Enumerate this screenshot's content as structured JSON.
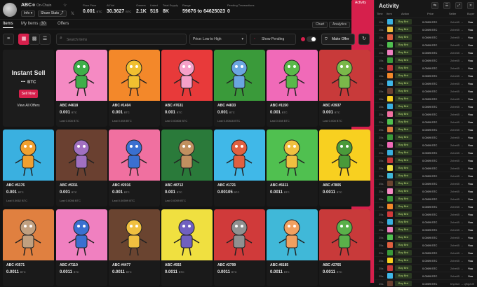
{
  "header": {
    "name": "ABC",
    "status": "On-Chain",
    "info_label": "Info",
    "share_label": "Share Stats",
    "stats": [
      {
        "label": "Floor Price",
        "value": "0.001",
        "unit": "BTC"
      },
      {
        "label": "All Vol",
        "value": "30.3627",
        "unit": "BTC"
      },
      {
        "label": "Owners",
        "value": "2.1K"
      },
      {
        "label": "Listed",
        "value": "516"
      },
      {
        "label": "Total Supply",
        "value": "8K"
      },
      {
        "label": "Range",
        "value": "59676 to 64625023"
      },
      {
        "label": "Pending Transactions",
        "value": "0"
      }
    ]
  },
  "tabs": {
    "items": "Items",
    "my_items": "My Items",
    "my_items_count": "30",
    "offers": "Offers"
  },
  "view_tabs": [
    "Chart",
    "Analytics",
    "Activity"
  ],
  "toolbar": {
    "search_placeholder": "Search items",
    "sort": "Price: Low to High",
    "pending": "Show Pending",
    "make_offer": "Make Offer"
  },
  "sell": {
    "title": "Instant Sell",
    "price": "--",
    "unit": "BTC",
    "button": "Sell Now",
    "view_all": "View All Offers"
  },
  "cards": [
    {
      "name": "ABC #4618",
      "price": "0.001",
      "unit": "BTC",
      "last": "Last 0.008 BTC",
      "bg": "#f58ac3",
      "fg": "#3fae4a"
    },
    {
      "name": "ABC #1404",
      "price": "0.001",
      "unit": "BTC",
      "last": "Last 0.008 BTC",
      "bg": "#f3882a",
      "fg": "#f0c030"
    },
    {
      "name": "ABC #7631",
      "price": "0.001",
      "unit": "BTC",
      "last": "Last 0.00808 BTC",
      "bg": "#e83a3a",
      "fg": "#f5a0c8"
    },
    {
      "name": "ABC #4833",
      "price": "0.001",
      "unit": "BTC",
      "last": "Last 0.00816 BTC",
      "bg": "#3a9a3a",
      "fg": "#6aa6e0"
    },
    {
      "name": "ABC #1150",
      "price": "0.001",
      "unit": "BTC",
      "last": "Last 0.008 BTC",
      "bg": "#f06ab8",
      "fg": "#5ab84a"
    },
    {
      "name": "ABC #3937",
      "price": "0.001",
      "unit": "BTC",
      "last": "Last 0.008 BTC",
      "bg": "#c83a3a",
      "fg": "#7ab84a"
    },
    {
      "name": "ABC #5176",
      "price": "0.001",
      "unit": "BTC",
      "last": "Last 0.0062 BTC",
      "bg": "#3ab0e0",
      "fg": "#f0a030"
    },
    {
      "name": "ABC #9311",
      "price": "0.001",
      "unit": "BTC",
      "last": "Last 0.0056 BTC",
      "bg": "#6a4030",
      "fg": "#a070c0"
    },
    {
      "name": "ABC #2016",
      "price": "0.001",
      "unit": "BTC",
      "last": "Last 0.00599 BTC",
      "bg": "#f070a0",
      "fg": "#3a70d0"
    },
    {
      "name": "ABC #8712",
      "price": "0.001",
      "unit": "BTC",
      "last": "Last 0.0059 BTC",
      "bg": "#2a7a3a",
      "fg": "#c09060"
    },
    {
      "name": "ABC #1721",
      "price": "0.00105",
      "unit": "BTC",
      "last": "",
      "bg": "#40b8e8",
      "fg": "#e06040"
    },
    {
      "name": "ABC #5611",
      "price": "0.0011",
      "unit": "BTC",
      "last": "",
      "bg": "#50c050",
      "fg": "#f0c040"
    },
    {
      "name": "ABC #7805",
      "price": "0.0011",
      "unit": "BTC",
      "last": "",
      "bg": "#f8d020",
      "fg": "#4a9a3a"
    },
    {
      "name": "ABC #3571",
      "price": "0.0011",
      "unit": "BTC",
      "last": "",
      "bg": "#e08040",
      "fg": "#c0a080"
    },
    {
      "name": "ABC #7110",
      "price": "0.0011",
      "unit": "BTC",
      "last": "",
      "bg": "#f080c0",
      "fg": "#3a70d0"
    },
    {
      "name": "ABC #4477",
      "price": "0.0011",
      "unit": "BTC",
      "last": "",
      "bg": "#6a4430",
      "fg": "#f0c040"
    },
    {
      "name": "ABC #592",
      "price": "0.0011",
      "unit": "BTC",
      "last": "",
      "bg": "#f0e040",
      "fg": "#7060c0"
    },
    {
      "name": "ABC #2799",
      "price": "0.0011",
      "unit": "BTC",
      "last": "",
      "bg": "#d03a3a",
      "fg": "#909090"
    },
    {
      "name": "ABC #8185",
      "price": "0.0011",
      "unit": "BTC",
      "last": "",
      "bg": "#40b8d8",
      "fg": "#f0a060"
    },
    {
      "name": "ABC #2765",
      "price": "0.0011",
      "unit": "BTC",
      "last": "",
      "bg": "#c83a3a",
      "fg": "#5ab04a"
    }
  ],
  "activity": {
    "title": "Activity",
    "columns": [
      "Time",
      "Item",
      "Action",
      "Price",
      "Seller",
      "Buyer"
    ],
    "rows": [
      {
        "t": "15s",
        "a": "Buy Brd",
        "p": "0.0009 BTC",
        "s": "2zhe65 →",
        "b": "You",
        "c": "#3ab0e0"
      },
      {
        "t": "15s",
        "a": "Buy Brd",
        "p": "0.0009 BTC",
        "s": "2zhe65 →",
        "b": "You",
        "c": "#f0c040"
      },
      {
        "t": "15s",
        "a": "Buy Brd",
        "p": "0.0009 BTC",
        "s": "2zhe65 →",
        "b": "You",
        "c": "#e06040"
      },
      {
        "t": "15s",
        "a": "Buy Brd",
        "p": "0.0009 BTC",
        "s": "2zhe65 →",
        "b": "You",
        "c": "#50c050"
      },
      {
        "t": "15s",
        "a": "Buy Brd",
        "p": "0.0009 BTC",
        "s": "2zhe65 →",
        "b": "You",
        "c": "#f080c0"
      },
      {
        "t": "15s",
        "a": "Buy Brd",
        "p": "0.0009 BTC",
        "s": "2zhe65 →",
        "b": "You",
        "c": "#3a9a3a"
      },
      {
        "t": "15s",
        "a": "Buy Brd",
        "p": "0.0009 BTC",
        "s": "2zhe65 →",
        "b": "You",
        "c": "#c83a3a"
      },
      {
        "t": "15s",
        "a": "Buy Brd",
        "p": "0.0009 BTC",
        "s": "2zhe65 →",
        "b": "You",
        "c": "#f3882a"
      },
      {
        "t": "15s",
        "a": "Buy Brd",
        "p": "0.0009 BTC",
        "s": "2zhe65 →",
        "b": "You",
        "c": "#40b8e8"
      },
      {
        "t": "15s",
        "a": "Buy Brd",
        "p": "0.0009 BTC",
        "s": "2zhe65 →",
        "b": "You",
        "c": "#6a4030"
      },
      {
        "t": "15s",
        "a": "Buy Brd",
        "p": "0.0009 BTC",
        "s": "2zhe65 →",
        "b": "You",
        "c": "#f8d020"
      },
      {
        "t": "15s",
        "a": "Buy Brd",
        "p": "0.0009 BTC",
        "s": "2zhe65 →",
        "b": "You",
        "c": "#3ab0e0"
      },
      {
        "t": "25s",
        "a": "Buy Brd",
        "p": "0.0009 BTC",
        "s": "2zhe65 →",
        "b": "You",
        "c": "#f070a0"
      },
      {
        "t": "25s",
        "a": "Buy Brd",
        "p": "0.0009 BTC",
        "s": "2zhe65 →",
        "b": "You",
        "c": "#50c050"
      },
      {
        "t": "25s",
        "a": "Buy Brd",
        "p": "0.0009 BTC",
        "s": "2zhe65 →",
        "b": "You",
        "c": "#e08040"
      },
      {
        "t": "25s",
        "a": "Buy Brd",
        "p": "0.0009 BTC",
        "s": "2zhe65 →",
        "b": "You",
        "c": "#3a9a3a"
      },
      {
        "t": "25s",
        "a": "Buy Brd",
        "p": "0.0009 BTC",
        "s": "2zhe65 →",
        "b": "You",
        "c": "#f06ab8"
      },
      {
        "t": "25s",
        "a": "Buy Brd",
        "p": "0.0009 BTC",
        "s": "2zhe65 →",
        "b": "You",
        "c": "#3ab0e0"
      },
      {
        "t": "25s",
        "a": "Buy Brd",
        "p": "0.0009 BTC",
        "s": "2zhe65 →",
        "b": "You",
        "c": "#c83a3a"
      },
      {
        "t": "25s",
        "a": "Buy Brd",
        "p": "0.0009 BTC",
        "s": "2zhe65 →",
        "b": "You",
        "c": "#f0e040"
      },
      {
        "t": "25s",
        "a": "Buy Brd",
        "p": "0.0009 BTC",
        "s": "2zhe65 →",
        "b": "You",
        "c": "#40b8d8"
      },
      {
        "t": "25s",
        "a": "Buy Brd",
        "p": "0.0009 BTC",
        "s": "2zhe65 →",
        "b": "You",
        "c": "#6a4430"
      },
      {
        "t": "25s",
        "a": "Buy Brd",
        "p": "0.0009 BTC",
        "s": "2zhe65 →",
        "b": "You",
        "c": "#f58ac3"
      },
      {
        "t": "25s",
        "a": "Buy Brd",
        "p": "0.0009 BTC",
        "s": "2zhe65 →",
        "b": "You",
        "c": "#3a9a3a"
      },
      {
        "t": "25s",
        "a": "Buy Brd",
        "p": "0.0009 BTC",
        "s": "2zhe65 →",
        "b": "You",
        "c": "#f3882a"
      },
      {
        "t": "25s",
        "a": "Buy Brd",
        "p": "0.0009 BTC",
        "s": "2zhe65 →",
        "b": "You",
        "c": "#d03a3a"
      },
      {
        "t": "25s",
        "a": "Buy Brd",
        "p": "0.0009 BTC",
        "s": "2zhe65 →",
        "b": "You",
        "c": "#3ab0e0"
      },
      {
        "t": "25s",
        "a": "Buy Brd",
        "p": "0.0009 BTC",
        "s": "2zhe65 →",
        "b": "You",
        "c": "#f080c0"
      },
      {
        "t": "25s",
        "a": "Buy Brd",
        "p": "0.0009 BTC",
        "s": "2zhe65 →",
        "b": "You",
        "c": "#50c050"
      },
      {
        "t": "25s",
        "a": "Buy Brd",
        "p": "0.0009 BTC",
        "s": "2zhe65 →",
        "b": "You",
        "c": "#e06040"
      },
      {
        "t": "25s",
        "a": "Buy Brd",
        "p": "0.0009 BTC",
        "s": "2zhe65 →",
        "b": "You",
        "c": "#3a9a3a"
      },
      {
        "t": "25s",
        "a": "Buy Brd",
        "p": "0.0009 BTC",
        "s": "2zhe65 →",
        "b": "You",
        "c": "#f8d020"
      },
      {
        "t": "25s",
        "a": "Buy Brd",
        "p": "0.0009 BTC",
        "s": "2zhe65 →",
        "b": "You",
        "c": "#c83a3a"
      },
      {
        "t": "25s",
        "a": "Buy Brd",
        "p": "0.0009 BTC",
        "s": "2zhe65 →",
        "b": "You",
        "c": "#40b8e8"
      },
      {
        "t": "25s",
        "a": "Buy Brd",
        "p": "0.0009 BTC",
        "s": "bhp3s3 → qfhg2dfl",
        "b": "",
        "c": "#6a4030"
      }
    ]
  }
}
